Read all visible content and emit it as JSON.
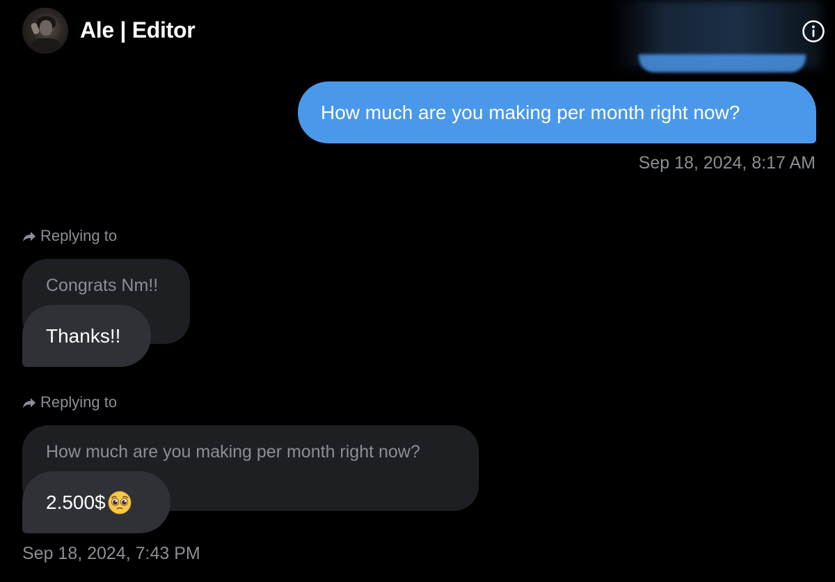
{
  "header": {
    "contact_name": "Ale | Editor",
    "avatar_icon": "profile-photo",
    "info_icon": "info-icon"
  },
  "messages": {
    "outgoing": {
      "text": "How much are you making per month right now?",
      "timestamp": "Sep 18, 2024, 8:17 AM",
      "bubble_color": "#4a98ea"
    },
    "reply_1": {
      "replying_label": "Replying to",
      "quoted_text": "Congrats Nm!!",
      "text": "Thanks!!"
    },
    "reply_2": {
      "replying_label": "Replying to",
      "quoted_text": "How much are you making per month right now?",
      "text": "2.500$",
      "emoji": "pleading-face",
      "timestamp": "Sep 18, 2024, 7:43 PM"
    }
  },
  "colors": {
    "background": "#000000",
    "incoming_bubble": "#2f3136",
    "quoted_bubble": "#1d1f23",
    "muted_text": "#8b8f94"
  }
}
